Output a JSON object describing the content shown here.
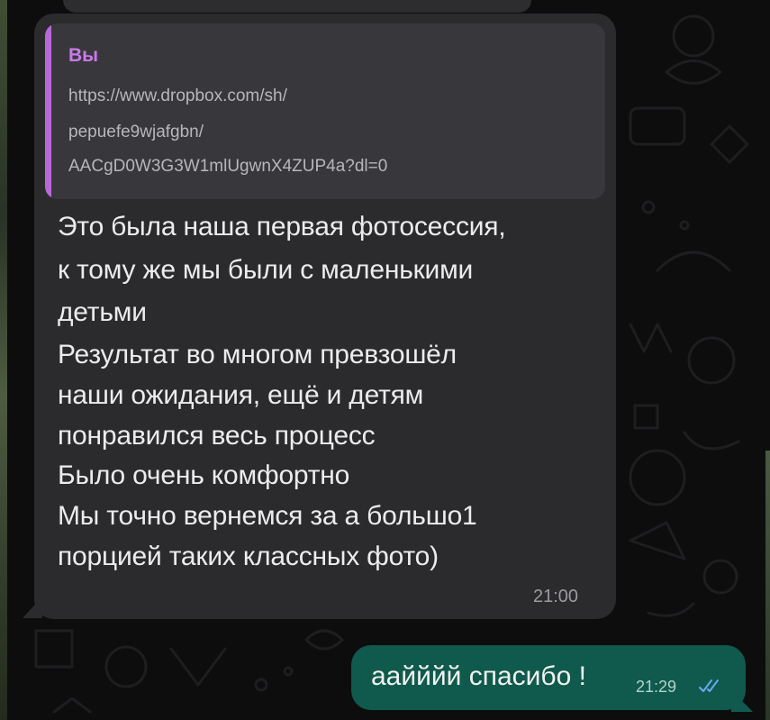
{
  "colors": {
    "background": "#0d0d0e",
    "incoming_bubble": "#2b2b2e",
    "reply_block": "#38383c",
    "reply_accent": "#b867d8",
    "outgoing_bubble": "#0f5a4c",
    "read_ticks": "#6aa9f5"
  },
  "chat": {
    "incoming": {
      "reply": {
        "sender": "Вы",
        "lines": [
          "https://www.dropbox.com/sh/",
          "pepuefe9wjafgbn/",
          "AACgD0W3G3W1mlUgwnX4ZUP4a?dl=0"
        ]
      },
      "lines": [
        "Это была наша первая фотосессия,",
        "к тому же мы были с маленькими",
        "детьми",
        "Результат во многом превзошёл",
        "наши ожидания, ещё и детям",
        "понравился весь процесс",
        "Было очень комфортно",
        "Мы точно вернемся за а большо1",
        "порцией таких классных фото)"
      ],
      "time": "21:00"
    },
    "outgoing": {
      "text": "аайййй спасибо !",
      "time": "21:29",
      "status_icon": "double-check-read-icon"
    }
  }
}
